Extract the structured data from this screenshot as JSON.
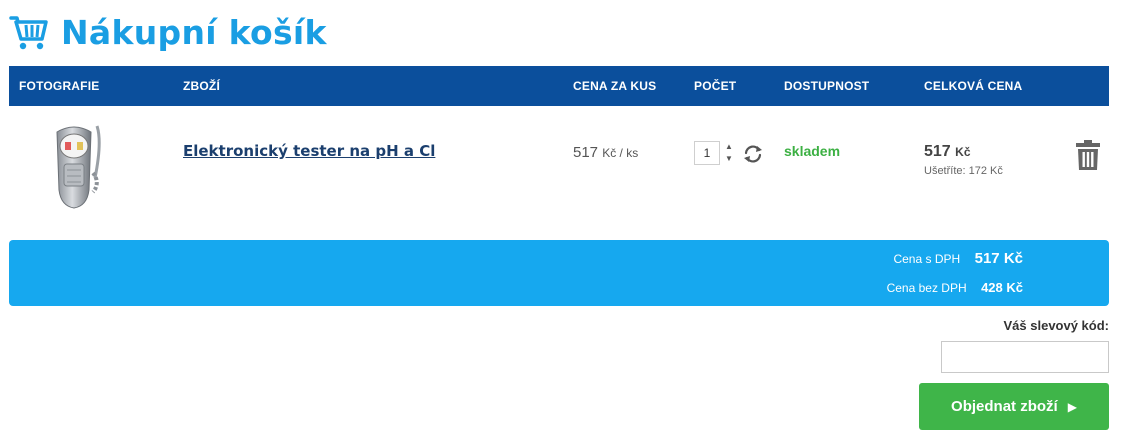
{
  "header": {
    "title": "Nákupní košík",
    "icon": "shopping-cart-icon",
    "accent_color": "#1a9ee3"
  },
  "table": {
    "header_color": "#0b4f9c",
    "columns": {
      "photo": "FOTOGRAFIE",
      "product": "ZBOŽÍ",
      "unit_price": "CENA ZA KUS",
      "quantity": "POČET",
      "availability": "DOSTUPNOST",
      "total": "CELKOVÁ CENA"
    },
    "rows": [
      {
        "image": "ph-chlorine-tester-image",
        "name": "Elektronický tester na pH a Cl",
        "unit_price": "517",
        "unit_price_unit": "Kč / ks",
        "quantity": "1",
        "availability": "skladem",
        "total_price": "517",
        "total_currency": "Kč",
        "savings": "Ušetříte: 172 Kč"
      }
    ]
  },
  "summary": {
    "background": "#16a8ef",
    "with_vat_label": "Cena s DPH",
    "with_vat_value": "517 Kč",
    "without_vat_label": "Cena bez DPH",
    "without_vat_value": "428 Kč"
  },
  "coupon": {
    "label": "Váš slevový kód:",
    "value": ""
  },
  "order_button": {
    "label": "Objednat zboží",
    "icon": "play-arrow-icon",
    "color": "#3fb549"
  }
}
